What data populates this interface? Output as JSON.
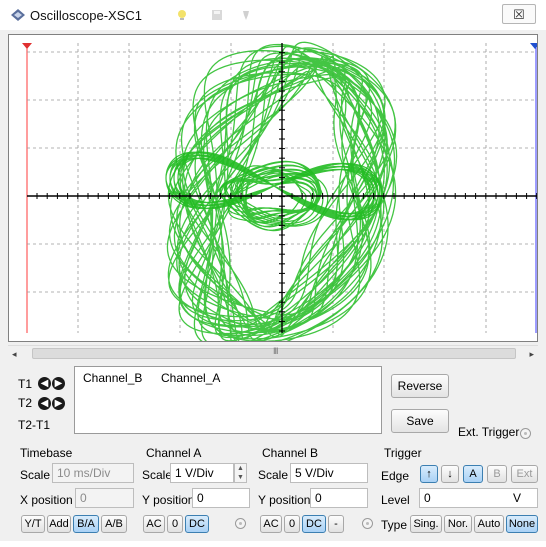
{
  "window": {
    "title": "Oscilloscope-XSC1",
    "close_glyph": "☒"
  },
  "colors": {
    "trace": "#22bb22",
    "grid": "#9a9a9a",
    "axis": "#000000",
    "active_button": "#a9d1f5"
  },
  "icons": {
    "app": "oscilloscope-icon",
    "toolbar": [
      "bulb-icon",
      "disk-icon",
      "pin-icon"
    ]
  },
  "scroll": {
    "left": "◂",
    "right": "▸",
    "grip": "III"
  },
  "cursors": {
    "t1": "T1",
    "t2": "T2",
    "t2_t1": "T2-T1",
    "left_arrow": "◀",
    "right_arrow": "▶"
  },
  "readout": {
    "columns": [
      "Channel_B",
      "Channel_A"
    ]
  },
  "buttons": {
    "reverse": "Reverse",
    "save": "Save",
    "ext_trigger": "Ext. Trigger"
  },
  "timebase": {
    "title": "Timebase",
    "scale_label": "Scale",
    "scale_value": "10 ms/Div",
    "xpos_label": "X position",
    "xpos_value": "0",
    "modes": [
      "Y/T",
      "Add",
      "B/A",
      "A/B"
    ],
    "active_mode": "B/A"
  },
  "channel_a": {
    "title": "Channel A",
    "scale_label": "Scale",
    "scale_value": "1  V/Div",
    "ypos_label": "Y position",
    "ypos_value": "0",
    "coupling": [
      "AC",
      "0",
      "DC"
    ],
    "active": "DC"
  },
  "channel_b": {
    "title": "Channel B",
    "scale_label": "Scale",
    "scale_value": "5  V/Div",
    "ypos_label": "Y position",
    "ypos_value": "0",
    "coupling": [
      "AC",
      "0",
      "DC",
      "-"
    ],
    "active": "DC"
  },
  "trigger": {
    "title": "Trigger",
    "edge_label": "Edge",
    "edge_buttons": [
      "↑",
      "↓",
      "A",
      "B",
      "Ext"
    ],
    "level_label": "Level",
    "level_value": "0",
    "level_unit": "V",
    "type_label": "Type",
    "types": [
      "Sing.",
      "Nor.",
      "Auto",
      "None"
    ],
    "active_type": "None"
  }
}
